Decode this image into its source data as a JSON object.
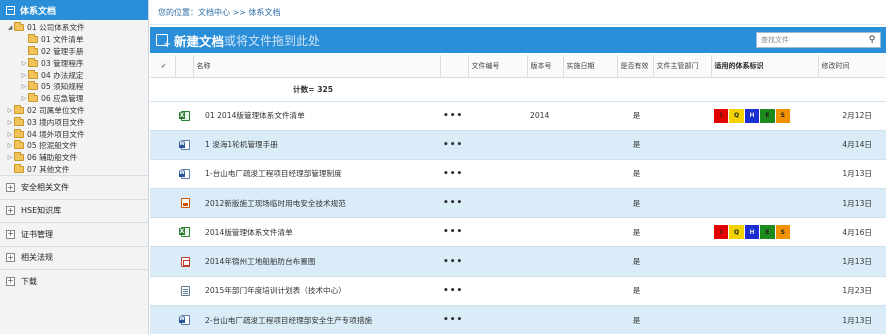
{
  "sidebar": {
    "header": "体系文档",
    "header_toggle": "−",
    "tree": [
      {
        "label": "01 公司体系文件",
        "level": 0,
        "toggle": "◢"
      },
      {
        "label": "01 文件清单",
        "level": 1,
        "toggle": ""
      },
      {
        "label": "02 管理手册",
        "level": 1,
        "toggle": ""
      },
      {
        "label": "03 管理程序",
        "level": 1,
        "toggle": "▷"
      },
      {
        "label": "04 办法规定",
        "level": 1,
        "toggle": "▷"
      },
      {
        "label": "05 须知规程",
        "level": 1,
        "toggle": "▷"
      },
      {
        "label": "06 应急管理",
        "level": 1,
        "toggle": "▷"
      },
      {
        "label": "02 司属单位文件",
        "level": 0,
        "toggle": "▷"
      },
      {
        "label": "03 境内项目文件",
        "level": 0,
        "toggle": "▷"
      },
      {
        "label": "04 境外项目文件",
        "level": 0,
        "toggle": "▷"
      },
      {
        "label": "05 挖泥船文件",
        "level": 0,
        "toggle": "▷"
      },
      {
        "label": "06 辅助船文件",
        "level": 0,
        "toggle": "▷"
      },
      {
        "label": "07 其他文件",
        "level": 0,
        "toggle": ""
      }
    ],
    "sections": [
      {
        "label": "安全相关文件",
        "toggle": "+"
      },
      {
        "label": "HSE知识库",
        "toggle": "+"
      },
      {
        "label": "证书管理",
        "toggle": "+"
      },
      {
        "label": "相关法规",
        "toggle": "+"
      },
      {
        "label": "下载",
        "toggle": "+"
      }
    ]
  },
  "breadcrumb": "您的位置：文档中心 >> 体系文档",
  "toolbar": {
    "new_title": "新建文档",
    "drag_hint": "或将文件拖到此处",
    "search_placeholder": "查找文件",
    "search_icon": "search-icon"
  },
  "table": {
    "headers": [
      "✓",
      "",
      "名称",
      "",
      "文件编号",
      "版本号",
      "实施日期",
      "是否有效",
      "文件主管部门",
      "适用的体系标识",
      "修改时间"
    ],
    "count_label": "计数= 325",
    "rows": [
      {
        "icon": "xls",
        "name": "01 2014版管理体系文件清单",
        "more": "•••",
        "version": "2014",
        "valid": "是",
        "marks": [
          "I",
          "Q",
          "H",
          "E",
          "S"
        ],
        "modified": "2月12日"
      },
      {
        "icon": "doc",
        "name": "1 浚海1轮机管理手册",
        "more": "•••",
        "version": "",
        "valid": "是",
        "marks": [],
        "modified": "4月14日"
      },
      {
        "icon": "doc",
        "name": "1-台山电厂疏浚工程项目经理部管理制度",
        "more": "•••",
        "version": "",
        "valid": "是",
        "marks": [],
        "modified": "1月13日"
      },
      {
        "icon": "ppt",
        "name": "2012新版施工现场临时用电安全技术规范",
        "more": "•••",
        "version": "",
        "valid": "是",
        "marks": [],
        "modified": "1月13日"
      },
      {
        "icon": "xls",
        "name": "2014版管理体系文件清单",
        "more": "•••",
        "version": "",
        "valid": "是",
        "marks": [
          "I",
          "Q",
          "H",
          "E",
          "S"
        ],
        "modified": "4月16日"
      },
      {
        "icon": "pdf",
        "name": "2014年锦州工地船舶防台布置图",
        "more": "•••",
        "version": "",
        "valid": "是",
        "marks": [],
        "modified": "1月13日"
      },
      {
        "icon": "txt",
        "name": "2015年部门年度培训计划表（技术中心）",
        "more": "•••",
        "version": "",
        "valid": "是",
        "marks": [],
        "modified": "1月23日"
      },
      {
        "icon": "doc",
        "name": "2-台山电厂疏浚工程项目经理部安全生产专项措施",
        "more": "•••",
        "version": "",
        "valid": "是",
        "marks": [],
        "modified": "1月13日"
      }
    ]
  },
  "colors": {
    "accent": "#2a8fd8",
    "row_alt": "#d9ecf8",
    "mark_I": "#e00000",
    "mark_Q": "#f2d200",
    "mark_H": "#1a2fd0",
    "mark_E": "#1d8a1d",
    "mark_S": "#f39200"
  }
}
